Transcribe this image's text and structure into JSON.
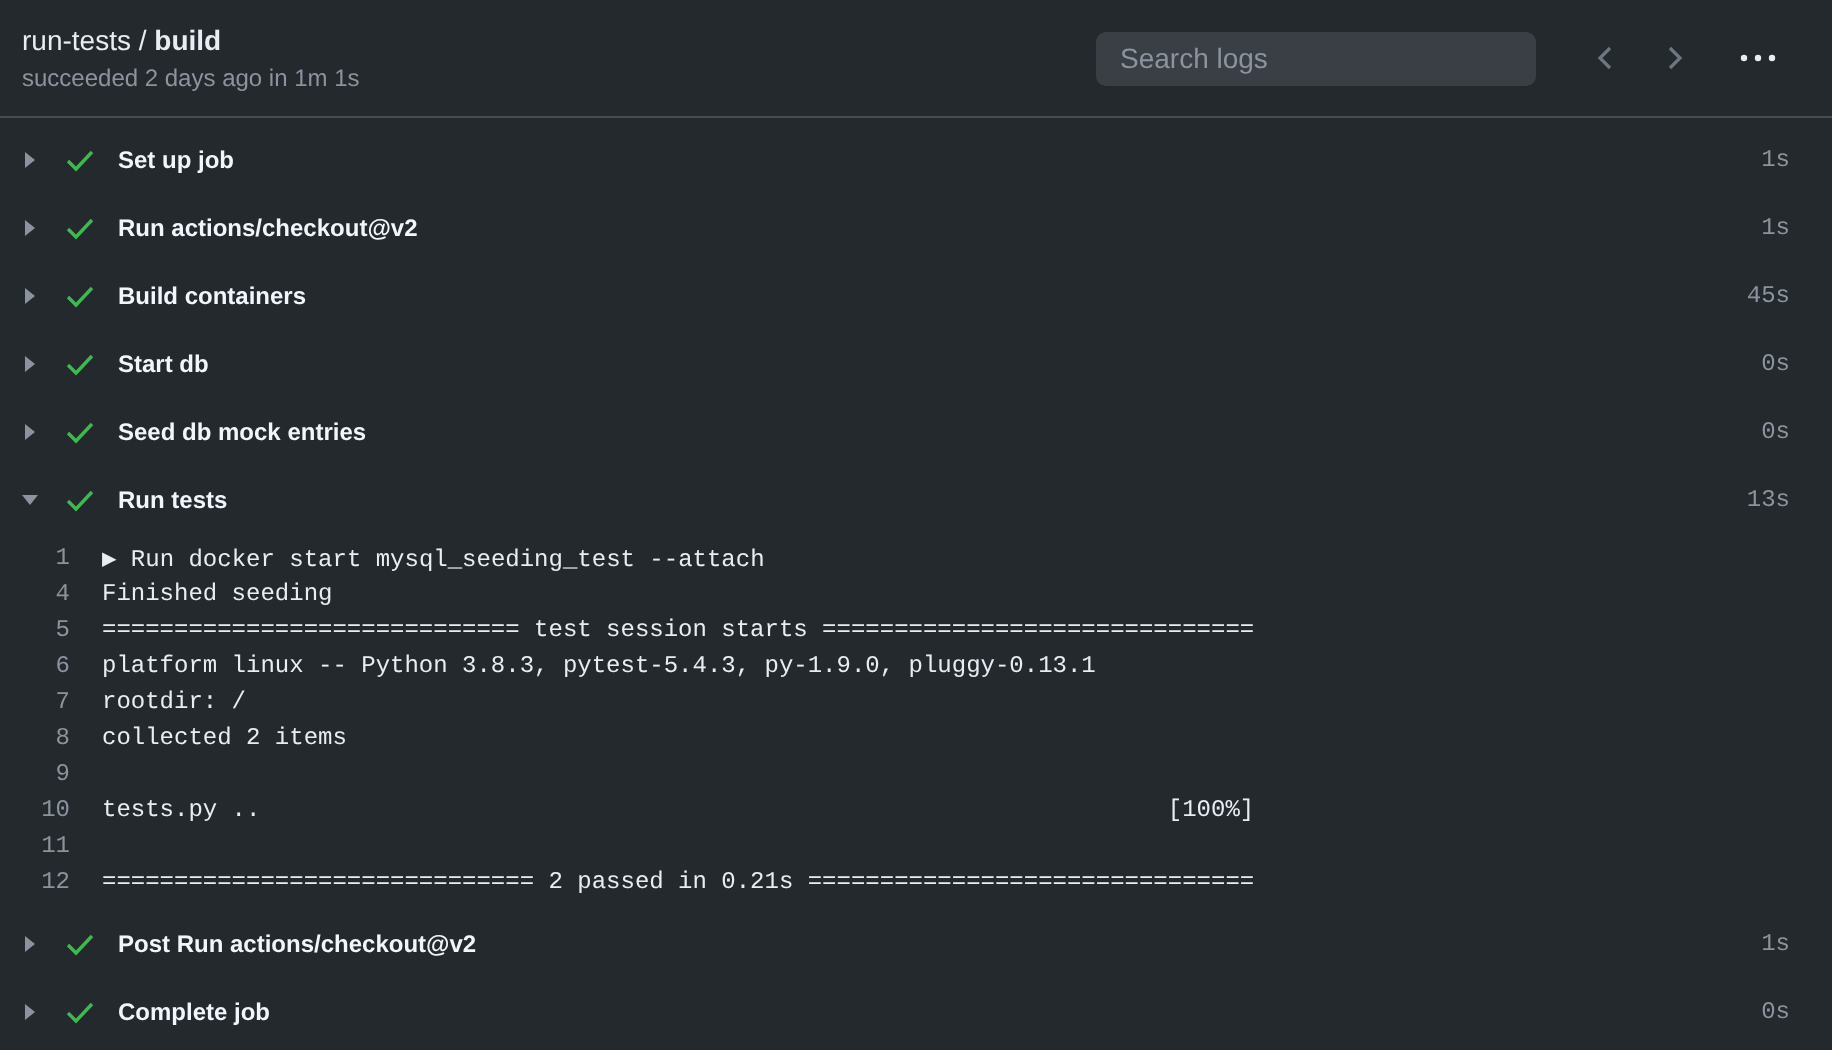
{
  "header": {
    "title": "run-tests / **build**",
    "subtitle": "succeeded 2 days ago in 1m 1s",
    "search": {
      "placeholder": "Search logs"
    }
  },
  "steps": [
    {
      "name": "Set up job",
      "duration": "1s",
      "succeeded": true,
      "expanded": false
    },
    {
      "name": "Run actions/checkout@v2",
      "duration": "1s",
      "succeeded": true,
      "expanded": false
    },
    {
      "name": "Build containers",
      "duration": "45s",
      "succeeded": true,
      "expanded": false
    },
    {
      "name": "Start db",
      "duration": "0s",
      "succeeded": true,
      "expanded": false
    },
    {
      "name": "Seed db mock entries",
      "duration": "0s",
      "succeeded": true,
      "expanded": false
    },
    {
      "name": "Run tests",
      "duration": "13s",
      "succeeded": true,
      "expanded": true,
      "log": [
        {
          "number": "1",
          "text": "▶ Run docker start mysql_seeding_test --attach"
        },
        {
          "number": "4",
          "text": "Finished seeding"
        },
        {
          "number": "5",
          "text": "============================= test session starts =============================="
        },
        {
          "number": "6",
          "text": "platform linux -- Python 3.8.3, pytest-5.4.3, py-1.9.0, pluggy-0.13.1"
        },
        {
          "number": "7",
          "text": "rootdir: /"
        },
        {
          "number": "8",
          "text": "collected 2 items"
        },
        {
          "number": "9"
        },
        {
          "number": "10",
          "text": "tests.py ..                                                               [100%]"
        },
        {
          "number": "11"
        },
        {
          "number": "12",
          "text": "============================== 2 passed in 0.21s ==============================="
        }
      ]
    },
    {
      "name": "Post Run actions/checkout@v2",
      "duration": "1s",
      "succeeded": true,
      "expanded": false
    },
    {
      "name": "Complete job",
      "duration": "0s",
      "succeeded": true,
      "expanded": false
    }
  ]
}
